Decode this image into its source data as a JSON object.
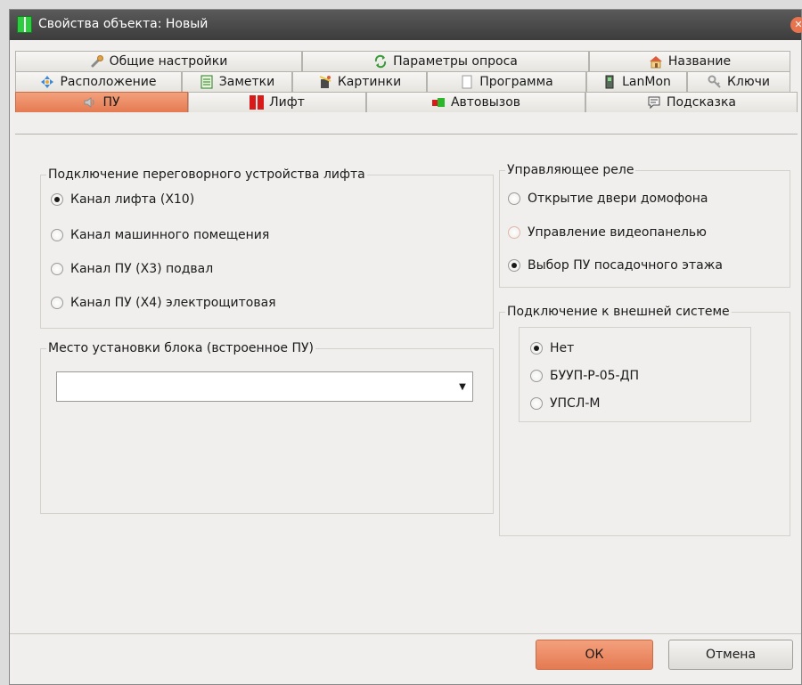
{
  "window": {
    "title": "Свойства объекта: Новый"
  },
  "tabs": {
    "row1": [
      {
        "label": "Общие настройки",
        "icon": "wrench-icon"
      },
      {
        "label": "Параметры опроса",
        "icon": "refresh-icon"
      },
      {
        "label": "Название",
        "icon": "house-icon"
      }
    ],
    "row2": [
      {
        "label": "Расположение",
        "icon": "move-arrows-icon"
      },
      {
        "label": "Заметки",
        "icon": "notes-icon"
      },
      {
        "label": "Картинки",
        "icon": "images-icon"
      },
      {
        "label": "Программа",
        "icon": "document-icon"
      },
      {
        "label": "LanMon",
        "icon": "device-icon"
      },
      {
        "label": "Ключи",
        "icon": "key-icon"
      }
    ],
    "row3": [
      {
        "label": "ПУ",
        "icon": "speaker-icon",
        "active": true
      },
      {
        "label": "Лифт",
        "icon": "elevator-icon"
      },
      {
        "label": "Автовызов",
        "icon": "flag-icon"
      },
      {
        "label": "Подсказка",
        "icon": "speech-bubble-icon"
      }
    ]
  },
  "intercom_group": {
    "legend": "Подключение переговорного устройства лифта",
    "options": [
      {
        "label": "Канал лифта (X10)",
        "checked": true
      },
      {
        "label": "Канал машинного помещения",
        "checked": false
      },
      {
        "label": "Канал ПУ (X3) подвал",
        "checked": false
      },
      {
        "label": "Канал ПУ (X4) электрощитовая",
        "checked": false
      }
    ]
  },
  "install_group": {
    "legend": "Место установки блока (встроенное ПУ)",
    "select_value": ""
  },
  "relay_group": {
    "legend": "Управляющее реле",
    "options": [
      {
        "label": "Открытие двери домофона",
        "checked": false
      },
      {
        "label": "Управление видеопанелью",
        "checked": false
      },
      {
        "label": "Выбор ПУ посадочного этажа",
        "checked": true
      }
    ]
  },
  "external_group": {
    "legend": "Подключение к внешней системе",
    "options": [
      {
        "label": "Нет",
        "checked": true
      },
      {
        "label": "БУУП-Р-05-ДП",
        "checked": false
      },
      {
        "label": "УПСЛ-М",
        "checked": false
      }
    ]
  },
  "buttons": {
    "ok": "ОК",
    "cancel": "Отмена"
  },
  "colors": {
    "accent": "#e8845c",
    "titlebar": "#4a4a4a",
    "close": "#e8744f"
  }
}
